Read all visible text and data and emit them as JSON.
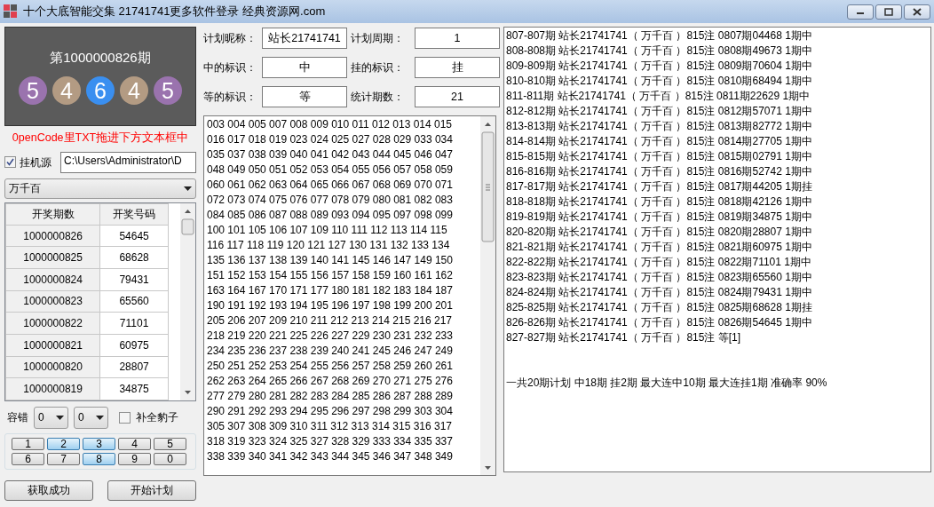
{
  "window": {
    "title": "十个大底智能交集 21741741更多软件登录 经典资源网.com"
  },
  "draw": {
    "title": "第1000000826期",
    "balls": [
      {
        "digit": "5",
        "color": "#9a73ae"
      },
      {
        "digit": "4",
        "color": "#b39b83"
      },
      {
        "digit": "6",
        "color": "#3a8ff0"
      },
      {
        "digit": "4",
        "color": "#b39b83"
      },
      {
        "digit": "5",
        "color": "#9a73ae"
      }
    ]
  },
  "hint": "0penCode里TXT拖进下方文本框中",
  "source": {
    "label": "挂机源",
    "checked": true,
    "path": "C:\\Users\\Administrator\\D"
  },
  "position_select": {
    "value": "万千百"
  },
  "table": {
    "columns": [
      "开奖期数",
      "开奖号码"
    ],
    "rows": [
      [
        "1000000826",
        "54645"
      ],
      [
        "1000000825",
        "68628"
      ],
      [
        "1000000824",
        "79431"
      ],
      [
        "1000000823",
        "65560"
      ],
      [
        "1000000822",
        "71101"
      ],
      [
        "1000000821",
        "60975"
      ],
      [
        "1000000820",
        "28807"
      ],
      [
        "1000000819",
        "34875"
      ]
    ]
  },
  "tolerance": {
    "label": "容错",
    "selects": [
      "0",
      "0"
    ],
    "fill_leopard": {
      "label": "补全豹子",
      "checked": false
    }
  },
  "digit_buttons": [
    {
      "label": "1",
      "selected": false
    },
    {
      "label": "2",
      "selected": true
    },
    {
      "label": "3",
      "selected": true
    },
    {
      "label": "4",
      "selected": false
    },
    {
      "label": "5",
      "selected": false
    },
    {
      "label": "6",
      "selected": false
    },
    {
      "label": "7",
      "selected": false
    },
    {
      "label": "8",
      "selected": true
    },
    {
      "label": "9",
      "selected": false
    },
    {
      "label": "0",
      "selected": false
    }
  ],
  "buttons": [
    "获取成功",
    "开始计划"
  ],
  "plan_form": [
    {
      "label": "计划昵称：",
      "value": "站长21741741"
    },
    {
      "label": "计划周期：",
      "value": "1"
    },
    {
      "label": "中的标识：",
      "value": "中"
    },
    {
      "label": "挂的标识：",
      "value": "挂"
    },
    {
      "label": "等的标识：",
      "value": "等"
    },
    {
      "label": "统计期数：",
      "value": "21"
    }
  ],
  "numbers_text": [
    "003 004 005 007 008 009 010 011 012 013 014 015",
    "016 017 018 019 023 024 025 027 028 029 033 034",
    "035 037 038 039 040 041 042 043 044 045 046 047",
    "048 049 050 051 052 053 054 055 056 057 058 059",
    "060 061 062 063 064 065 066 067 068 069 070 071",
    "072 073 074 075 076 077 078 079 080 081 082 083",
    "084 085 086 087 088 089 093 094 095 097 098 099",
    "100 101 105 106 107 109 110 111 112 113 114 115",
    "116 117 118 119 120 121 127 130 131 132 133 134",
    "135 136 137 138 139 140 141 145 146 147 149 150",
    "151 152 153 154 155 156 157 158 159 160 161 162",
    "163 164 167 170 171 177 180 181 182 183 184 187",
    "190 191 192 193 194 195 196 197 198 199 200 201",
    "205 206 207 209 210 211 212 213 214 215 216 217",
    "218 219 220 221 225 226 227 229 230 231 232 233",
    "234 235 236 237 238 239 240 241 245 246 247 249",
    "250 251 252 253 254 255 256 257 258 259 260 261",
    "262 263 264 265 266 267 268 269 270 271 275 276",
    "277 279 280 281 282 283 284 285 286 287 288 289",
    "290 291 292 293 294 295 296 297 298 299 303 304",
    "305 307 308 309 310 311 312 313 314 315 316 317",
    "318 319 323 324 325 327 328 329 333 334 335 337",
    "338 339 340 341 342 343 344 345 346 347 348 349"
  ],
  "results": [
    "807-807期 站长21741741（ 万千百 ）815注 0807期04468 1期中",
    "808-808期 站长21741741（ 万千百 ）815注 0808期49673 1期中",
    "809-809期 站长21741741（ 万千百 ）815注 0809期70604 1期中",
    "810-810期 站长21741741（ 万千百 ）815注 0810期68494 1期中",
    "811-811期 站长21741741（ 万千百 ）815注 0811期22629 1期中",
    "812-812期 站长21741741（ 万千百 ）815注 0812期57071 1期中",
    "813-813期 站长21741741（ 万千百 ）815注 0813期82772 1期中",
    "814-814期 站长21741741（ 万千百 ）815注 0814期27705 1期中",
    "815-815期 站长21741741（ 万千百 ）815注 0815期02791 1期中",
    "816-816期 站长21741741（ 万千百 ）815注 0816期52742 1期中",
    "817-817期 站长21741741（ 万千百 ）815注 0817期44205 1期挂",
    "818-818期 站长21741741（ 万千百 ）815注 0818期42126 1期中",
    "819-819期 站长21741741（ 万千百 ）815注 0819期34875 1期中",
    "820-820期 站长21741741（ 万千百 ）815注 0820期28807 1期中",
    "821-821期 站长21741741（ 万千百 ）815注 0821期60975 1期中",
    "822-822期 站长21741741（ 万千百 ）815注 0822期71101 1期中",
    "823-823期 站长21741741（ 万千百 ）815注 0823期65560 1期中",
    "824-824期 站长21741741（ 万千百 ）815注 0824期79431 1期中",
    "825-825期 站长21741741（ 万千百 ）815注 0825期68628 1期挂",
    "826-826期 站长21741741（ 万千百 ）815注 0826期54645 1期中",
    "827-827期 站长21741741（ 万千百 ）815注 等[1]"
  ],
  "summary": "一共20期计划 中18期 挂2期 最大连中10期 最大连挂1期 准确率 90%"
}
